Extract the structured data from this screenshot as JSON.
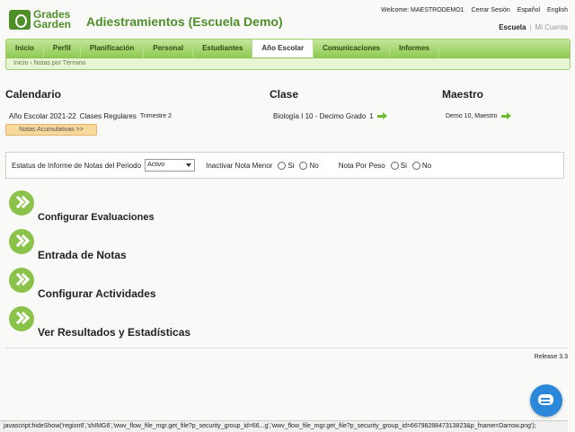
{
  "header": {
    "logo_line1": "Grades",
    "logo_line2": "Garden",
    "title": "Adiestramientos (Escuela Demo)",
    "welcome": "Welcome: MAESTRODEMO1",
    "logout": "Cerrar Sesión",
    "lang_es": "Español",
    "lang_en": "English",
    "escuela": "Escuela",
    "sep": "|",
    "mi_cuenta": "Mi Cuenta"
  },
  "nav": {
    "tabs": [
      "Inicio",
      "Perfil",
      "Planificación",
      "Personal",
      "Estudiantes",
      "Año Escolar",
      "Comunicaciones",
      "Informes"
    ],
    "active_tab": "Año Escolar",
    "breadcrumb": [
      "Inicio",
      "Notas por Término"
    ],
    "breadcrumb_sep": "›"
  },
  "sections": {
    "calendario": "Calendario",
    "clase": "Clase",
    "maestro": "Maestro"
  },
  "info": {
    "year": "Año Escolar 2021-22",
    "classes": "Clases Regulares",
    "term": "Trimestre 2",
    "clase": "Biología I 10 -  Decimo Grado",
    "clase_count": "1",
    "maestro": "Demo 10, Maestro",
    "notas_btn": "Notas Acumulativas >>"
  },
  "statusbar": {
    "status_label": "Estatus de Informe de Notas del Periodo",
    "status_value": "Activo",
    "inactivar_label": "Inactivar Nota Menor",
    "peso_label": "Nota Por Peso",
    "si": "Si",
    "no": "No"
  },
  "actions": {
    "configurar_evaluaciones": "Configurar Evaluaciones",
    "entrada_notas": "Entrada de Notas",
    "configurar_actividades": "Configurar Actividades",
    "resultados": "Ver Resultados y Estadísticas"
  },
  "footer": {
    "release": "Release 3.3",
    "statusline": "javascript:hideShow('region6','shIMG6','wwv_flow_file_mgr.get_file?p_security_group_id=66...g','wwv_flow_file_mgr.get_file?p_security_group_id=6679828847313823&p_fname=Darrow.png');"
  }
}
